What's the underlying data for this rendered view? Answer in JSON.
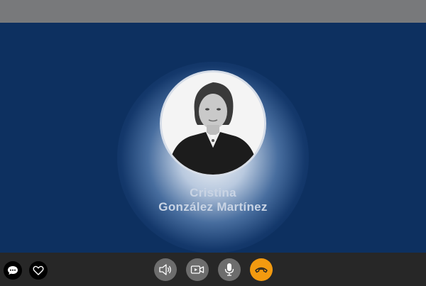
{
  "caller": {
    "first_name": "Cristina",
    "last_name": "González Martínez"
  },
  "controls": {
    "chat": {
      "icon": "chat-bubble-icon"
    },
    "favorite": {
      "icon": "heart-icon"
    },
    "speaker": {
      "icon": "speaker-icon"
    },
    "video": {
      "icon": "video-camera-icon"
    },
    "microphone": {
      "icon": "microphone-icon"
    },
    "hang_up": {
      "icon": "phone-hangup-icon"
    }
  },
  "colors": {
    "background": "#0d3060",
    "top_bar": "#78797b",
    "bottom_bar": "#272727",
    "control_button": "#6d6d6d",
    "hang_up_button": "#f29a10",
    "name_text": "#c9d4e4"
  }
}
